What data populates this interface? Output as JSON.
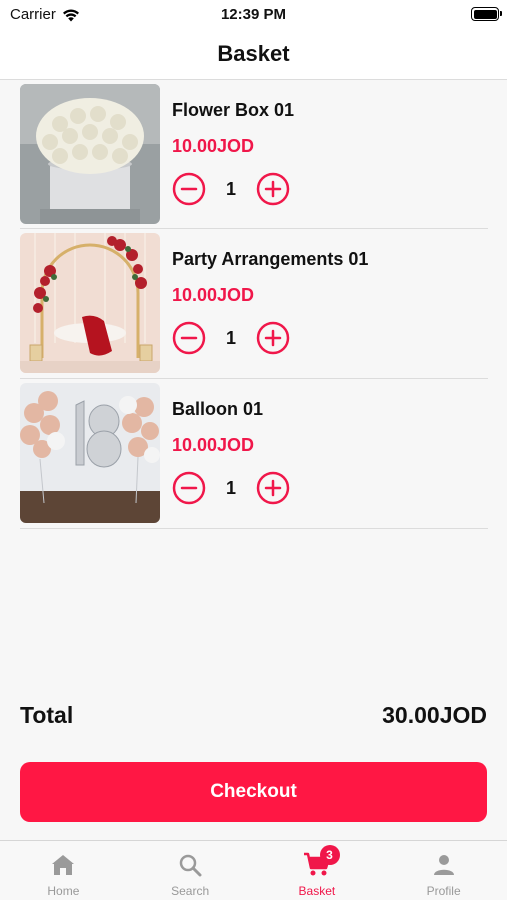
{
  "status_bar": {
    "carrier": "Carrier",
    "time": "12:39 PM"
  },
  "header": {
    "title": "Basket"
  },
  "items": [
    {
      "name": "Flower Box 01",
      "price": "10.00JOD",
      "quantity": "1"
    },
    {
      "name": "Party Arrangements 01",
      "price": "10.00JOD",
      "quantity": "1"
    },
    {
      "name": "Balloon 01",
      "price": "10.00JOD",
      "quantity": "1"
    }
  ],
  "total": {
    "label": "Total",
    "value": "30.00JOD"
  },
  "checkout": {
    "label": "Checkout"
  },
  "tabs": [
    {
      "label": "Home",
      "icon": "home-icon"
    },
    {
      "label": "Search",
      "icon": "search-icon"
    },
    {
      "label": "Basket",
      "icon": "cart-icon",
      "badge": "3",
      "active": true
    },
    {
      "label": "Profile",
      "icon": "person-icon"
    }
  ],
  "colors": {
    "accent": "#f0174a",
    "button": "#ff1744",
    "inactive_tab": "#999999"
  }
}
